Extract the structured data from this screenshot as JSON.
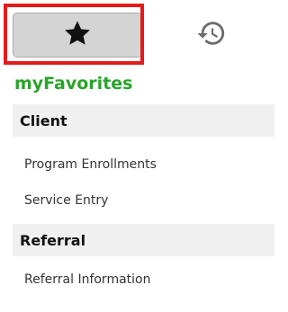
{
  "tabs": {
    "favorites": {
      "icon": "star-icon",
      "selected": true
    },
    "history": {
      "icon": "history-icon"
    }
  },
  "title": "myFavorites",
  "sections": [
    {
      "header": "Client",
      "items": [
        "Program Enrollments",
        "Service Entry"
      ]
    },
    {
      "header": "Referral",
      "items": [
        "Referral Information"
      ]
    }
  ],
  "colors": {
    "title": "#2aa32a",
    "highlight_border": "#e31b1b",
    "tab_selected_bg": "#d4d4d4",
    "section_bg": "#f0f0f0",
    "icon_dark": "#111111",
    "icon_gray": "#6d6d6d"
  }
}
